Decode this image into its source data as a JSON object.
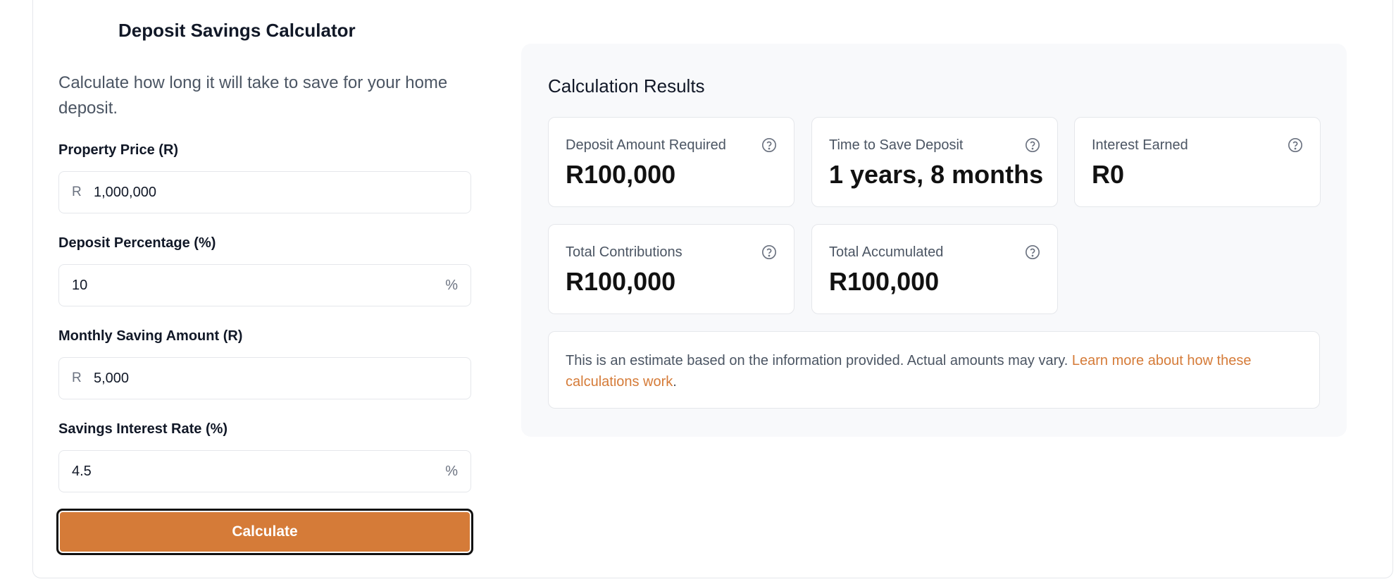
{
  "calculator": {
    "title": "Deposit Savings Calculator",
    "subtitle": "Calculate how long it will take to save for your home deposit.",
    "fields": {
      "property_price": {
        "label": "Property Price (R)",
        "prefix": "R",
        "value": "1,000,000"
      },
      "deposit_percentage": {
        "label": "Deposit Percentage (%)",
        "suffix": "%",
        "value": "10"
      },
      "monthly_saving": {
        "label": "Monthly Saving Amount (R)",
        "prefix": "R",
        "value": "5,000"
      },
      "interest_rate": {
        "label": "Savings Interest Rate (%)",
        "suffix": "%",
        "value": "4.5"
      }
    },
    "calculate_label": "Calculate",
    "accent_color": "#d57b38"
  },
  "results": {
    "title": "Calculation Results",
    "cards": [
      {
        "label": "Deposit Amount Required",
        "value": "R100,000",
        "icon": "help-circle-icon"
      },
      {
        "label": "Time to Save Deposit",
        "value": "1 years, 8 months",
        "icon": "help-circle-icon"
      },
      {
        "label": "Interest Earned",
        "value": "R0",
        "icon": "help-circle-icon"
      },
      {
        "label": "Total Contributions",
        "value": "R100,000",
        "icon": "help-circle-icon"
      },
      {
        "label": "Total Accumulated",
        "value": "R100,000",
        "icon": "help-circle-icon"
      }
    ],
    "note": {
      "text": "This is an estimate based on the information provided. Actual amounts may vary. ",
      "link": "Learn more about how these calculations work",
      "end": "."
    }
  }
}
